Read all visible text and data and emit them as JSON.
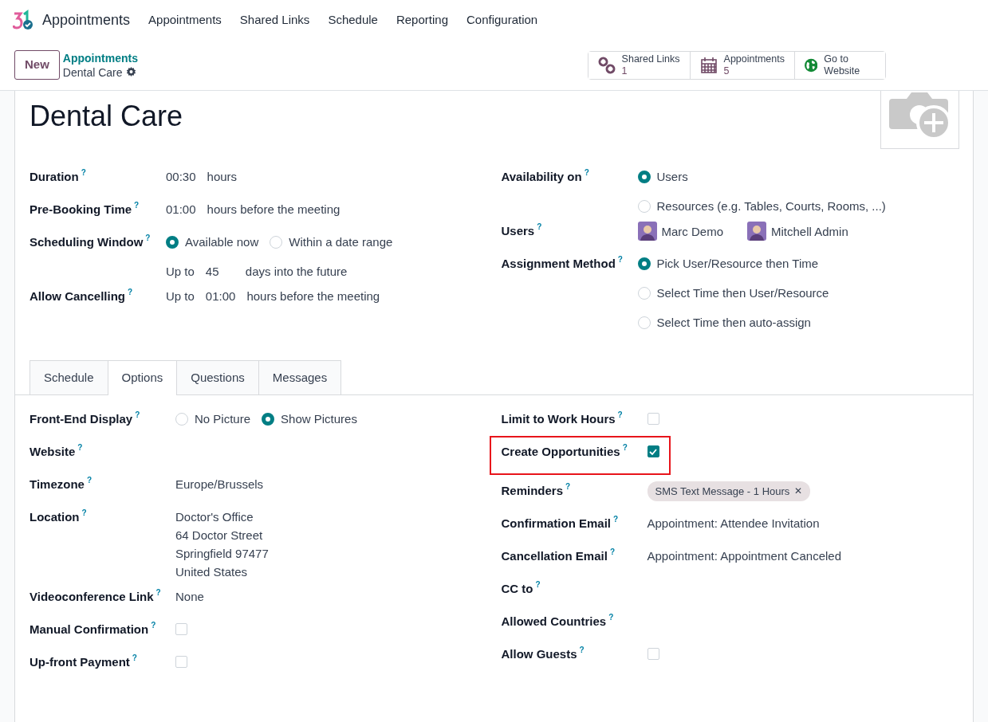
{
  "navbar": {
    "app": "Appointments",
    "menu": [
      "Appointments",
      "Shared Links",
      "Schedule",
      "Reporting",
      "Configuration"
    ]
  },
  "control_panel": {
    "new_button": "New",
    "breadcrumb": "Appointments",
    "record": "Dental Care"
  },
  "stat_buttons": [
    {
      "kind": "link",
      "label": "Shared Links",
      "value": "1"
    },
    {
      "kind": "calendar",
      "label": "Appointments",
      "value": "5"
    },
    {
      "kind": "globe",
      "label": "Go to Website"
    }
  ],
  "form": {
    "title": "Dental Care",
    "left_fields": [
      {
        "label": "Duration",
        "help": "?",
        "lines": [
          [
            {
              "kind": "input",
              "text": "00:30"
            },
            {
              "kind": "text",
              "text": "hours"
            }
          ]
        ]
      },
      {
        "label": "Pre-Booking Time",
        "help": "?",
        "lines": [
          [
            {
              "kind": "input",
              "text": "01:00"
            },
            {
              "kind": "text",
              "text": "hours before the meeting"
            }
          ]
        ]
      },
      {
        "label": "Scheduling Window",
        "help": "?",
        "lines": [
          [
            {
              "kind": "radio",
              "label": "Available now",
              "selected": true
            },
            {
              "kind": "radio",
              "label": "Within a date range",
              "selected": false
            }
          ],
          [
            {
              "kind": "text",
              "text": "Up to"
            },
            {
              "kind": "input",
              "text": "45"
            },
            {
              "kind": "text",
              "text": "days into the future"
            }
          ]
        ]
      },
      {
        "label": "Allow Cancelling",
        "help": "?",
        "lines": [
          [
            {
              "kind": "text",
              "text": "Up to"
            },
            {
              "kind": "input",
              "text": "01:00"
            },
            {
              "kind": "text",
              "text": "hours before the meeting"
            }
          ]
        ]
      }
    ],
    "right_fields": [
      {
        "label": "Availability on",
        "help": "?",
        "lines": [
          [
            {
              "kind": "radio",
              "label": "Users",
              "selected": true
            }
          ],
          [
            {
              "kind": "radio",
              "label": "Resources (e.g. Tables, Courts, Rooms, ...)",
              "selected": false
            }
          ]
        ]
      },
      {
        "label": "Users",
        "help": "?",
        "lines": [
          [
            {
              "kind": "user",
              "name": "Marc Demo"
            },
            {
              "kind": "user",
              "name": "Mitchell Admin"
            }
          ]
        ]
      },
      {
        "label": "Assignment Method",
        "help": "?",
        "lines": [
          [
            {
              "kind": "radio",
              "label": "Pick User/Resource then Time",
              "selected": true
            }
          ],
          [
            {
              "kind": "radio",
              "label": "Select Time then User/Resource",
              "selected": false
            }
          ],
          [
            {
              "kind": "radio",
              "label": "Select Time then auto-assign",
              "selected": false
            }
          ]
        ]
      }
    ]
  },
  "tabs": [
    {
      "label": "Schedule",
      "selected": false
    },
    {
      "label": "Options",
      "selected": true
    },
    {
      "label": "Questions",
      "selected": false
    },
    {
      "label": "Messages",
      "selected": false
    }
  ],
  "options_tab": {
    "left_fields": [
      {
        "label": "Front-End Display",
        "help": "?",
        "lines": [
          [
            {
              "kind": "radio",
              "label": "No Picture",
              "selected": false
            },
            {
              "kind": "radio",
              "label": "Show Pictures",
              "selected": true
            }
          ]
        ]
      },
      {
        "label": "Website",
        "help": "?"
      },
      {
        "label": "Timezone",
        "help": "?",
        "lines": [
          [
            {
              "kind": "text",
              "text": "Europe/Brussels"
            }
          ]
        ]
      },
      {
        "label": "Location",
        "help": "?",
        "lines": [
          [
            {
              "kind": "text",
              "text": "Doctor's Office"
            }
          ],
          [
            {
              "kind": "text",
              "text": "64 Doctor Street"
            }
          ],
          [
            {
              "kind": "text",
              "text": "Springfield 97477"
            }
          ],
          [
            {
              "kind": "text",
              "text": "United States"
            }
          ]
        ]
      },
      {
        "label": "Videoconference Link",
        "help": "?",
        "lines": [
          [
            {
              "kind": "text",
              "text": "None"
            }
          ]
        ]
      },
      {
        "label": "Manual Confirmation",
        "help": "?",
        "lines": [
          [
            {
              "kind": "checkbox",
              "checked": false
            }
          ]
        ]
      },
      {
        "label": "Up-front Payment",
        "help": "?",
        "lines": [
          [
            {
              "kind": "checkbox",
              "checked": false
            }
          ]
        ]
      }
    ],
    "right_fields": [
      {
        "label": "Limit to Work Hours",
        "help": "?",
        "lines": [
          [
            {
              "kind": "checkbox",
              "checked": false
            }
          ]
        ]
      },
      {
        "label": "Create Opportunities",
        "help": "?",
        "highlighted": true,
        "lines": [
          [
            {
              "kind": "checkbox",
              "checked": true
            }
          ]
        ]
      },
      {
        "label": "Reminders",
        "help": "?",
        "lines": [
          [
            {
              "kind": "tag",
              "label": "SMS Text Message - 1 Hours",
              "remove": "✕"
            }
          ]
        ]
      },
      {
        "label": "Confirmation Email",
        "help": "?",
        "lines": [
          [
            {
              "kind": "text",
              "text": "Appointment: Attendee Invitation"
            }
          ]
        ]
      },
      {
        "label": "Cancellation Email",
        "help": "?",
        "lines": [
          [
            {
              "kind": "text",
              "text": "Appointment: Appointment Canceled"
            }
          ]
        ]
      },
      {
        "label": "CC to",
        "help": "?"
      },
      {
        "label": "Allowed Countries",
        "help": "?"
      },
      {
        "label": "Allow Guests",
        "help": "?",
        "lines": [
          [
            {
              "kind": "checkbox",
              "checked": false
            }
          ]
        ]
      }
    ]
  }
}
